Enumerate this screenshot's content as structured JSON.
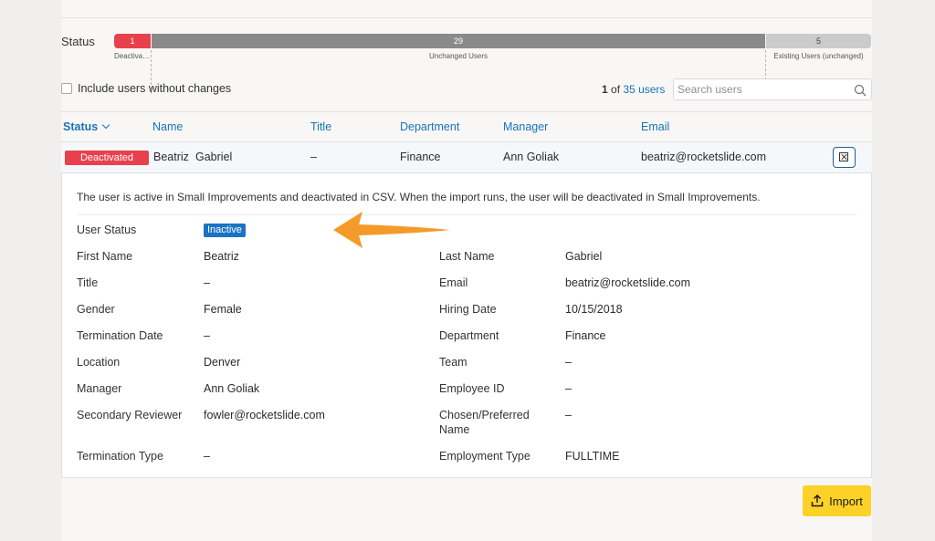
{
  "status_bar": {
    "label": "Status",
    "segments": [
      {
        "count": "1",
        "caption": "Deactivated Users"
      },
      {
        "count": "29",
        "caption": "Unchanged Users"
      },
      {
        "count": "5",
        "caption": "Existing Users (unchanged)"
      }
    ]
  },
  "filters": {
    "include_label": "Include users without changes",
    "count_current": "1",
    "count_of": "of",
    "count_total": "35 users",
    "search_placeholder": "Search users"
  },
  "table": {
    "headers": {
      "status": "Status",
      "name": "Name",
      "title": "Title",
      "department": "Department",
      "manager": "Manager",
      "email": "Email"
    },
    "row": {
      "status": "Deactivated",
      "first_name": "Beatriz",
      "last_name": "Gabriel",
      "title": "–",
      "department": "Finance",
      "manager": "Ann Goliak",
      "email": "beatriz@rocketslide.com"
    }
  },
  "details": {
    "message": "The user is active in Small Improvements and deactivated in CSV. When the import runs, the user will be deactivated in Small Improvements.",
    "user_status_label": "User Status",
    "user_status_value": "Inactive",
    "left": [
      {
        "label": "First Name",
        "value": "Beatriz"
      },
      {
        "label": "Title",
        "value": "–"
      },
      {
        "label": "Gender",
        "value": "Female"
      },
      {
        "label": "Termination Date",
        "value": "–"
      },
      {
        "label": "Location",
        "value": "Denver"
      },
      {
        "label": "Manager",
        "value": "Ann Goliak"
      },
      {
        "label": "Secondary Reviewer",
        "value": "fowler@rocketslide.com"
      },
      {
        "label": "Termination Type",
        "value": "–"
      }
    ],
    "right": [
      {
        "label": "Last Name",
        "value": "Gabriel"
      },
      {
        "label": "Email",
        "value": "beatriz@rocketslide.com"
      },
      {
        "label": "Hiring Date",
        "value": "10/15/2018"
      },
      {
        "label": "Department",
        "value": "Finance"
      },
      {
        "label": "Team",
        "value": "–"
      },
      {
        "label": "Employee ID",
        "value": "–"
      },
      {
        "label": "Chosen/Preferred Name",
        "value": "–"
      },
      {
        "label": "Employment Type",
        "value": "FULLTIME"
      }
    ]
  },
  "actions": {
    "import_label": "Import"
  },
  "colors": {
    "deactivated": "#e8414d",
    "unchanged": "#8a8a8a",
    "existing": "#cbcbcb",
    "accent_blue": "#1a73b8",
    "import_button": "#fcd228",
    "annotation_arrow": "#f39a2b"
  },
  "icons": {
    "sort": "chevron-down-icon",
    "search": "search-icon",
    "close": "close-icon",
    "import": "upload-icon"
  }
}
